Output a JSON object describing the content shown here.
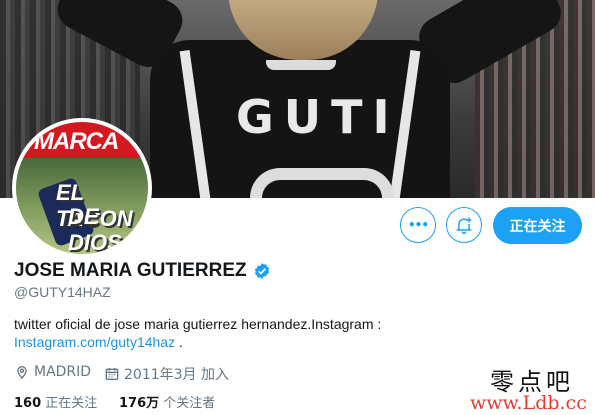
{
  "banner": {
    "shirt_text": "GUTI"
  },
  "avatar": {
    "top_text": "MARCA",
    "headline_line1": "EL TACON",
    "headline_line2": "DE DIOS"
  },
  "actions": {
    "more_label": "•••",
    "follow_label": "正在关注"
  },
  "profile": {
    "name": "JOSE MARIA GUTIERREZ",
    "handle": "@GUTY14HAZ",
    "bio_line1": "twitter oficial de jose maria gutierrez hernandez.Instagram :",
    "bio_link": "Instagram.com/guty14haz",
    "bio_suffix": " .",
    "location": "MADRID",
    "joined": "2011年3月 加入",
    "following_count": "160",
    "following_label": "正在关注",
    "followers_count": "176万",
    "followers_label": "个关注者"
  },
  "watermark": {
    "line1": "零点吧",
    "line2": "www.Ldb.cc"
  },
  "colors": {
    "accent": "#1da1f2",
    "secondary_text": "#657786",
    "link": "#1b95e0"
  }
}
